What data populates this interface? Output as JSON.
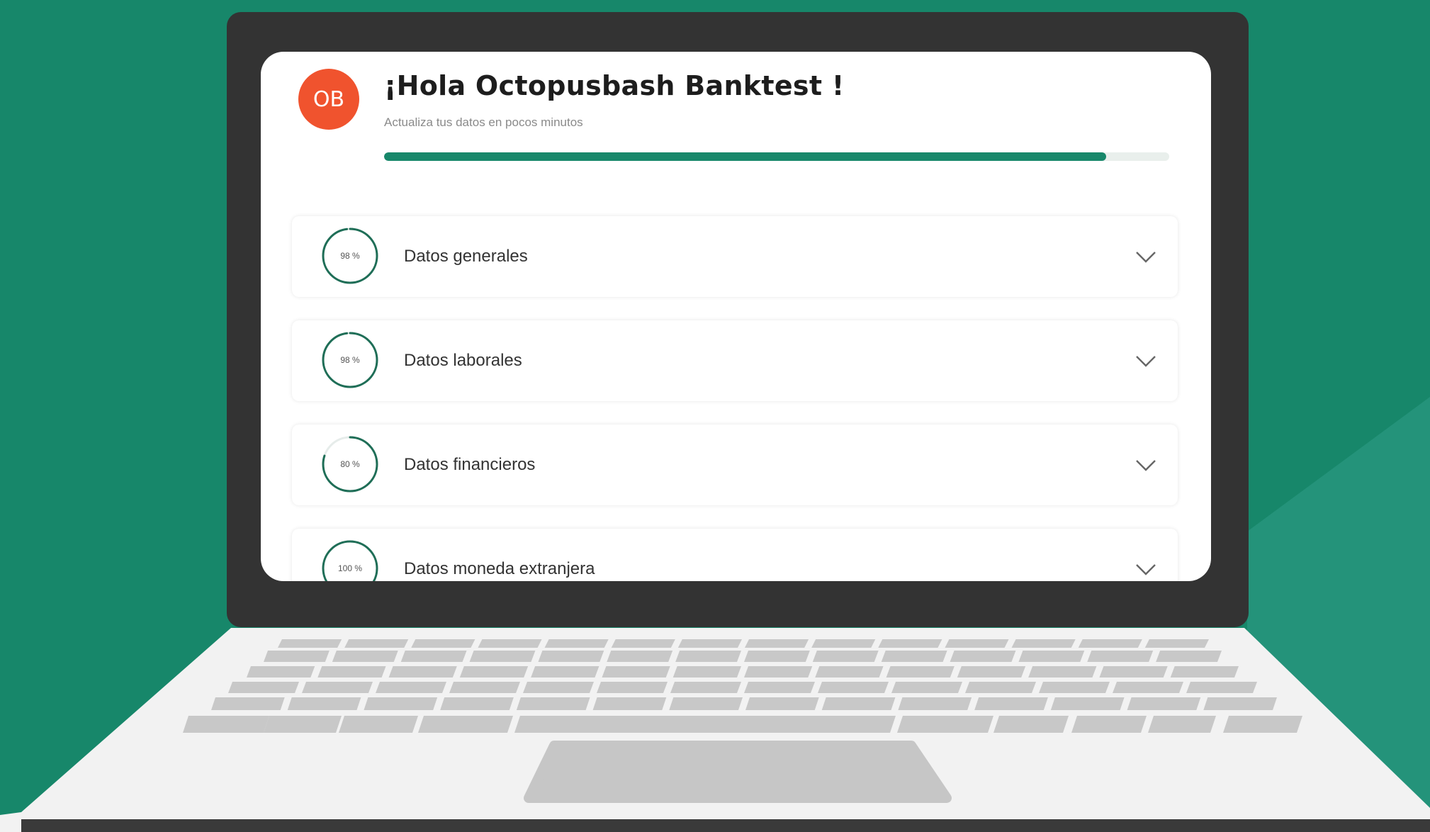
{
  "colors": {
    "background": "#17876a",
    "accent": "#17876a",
    "avatar": "#f0532e",
    "lid": "#333333",
    "laptop_base": "#f2f2f2",
    "keys": "#c8c8c8"
  },
  "header": {
    "avatar_initials": "OB",
    "greeting": "¡Hola Octopusbash Banktest !",
    "subtitle": "Actualiza tus datos en pocos minutos",
    "progress": 0.92
  },
  "sections": [
    {
      "label": "Datos generales",
      "percent_label": "98 %",
      "progress": 0.98,
      "icon": "chevron-down-icon"
    },
    {
      "label": "Datos laborales",
      "percent_label": "98 %",
      "progress": 0.98,
      "icon": "chevron-down-icon"
    },
    {
      "label": "Datos financieros",
      "percent_label": "80 %",
      "progress": 0.8,
      "icon": "chevron-down-icon"
    },
    {
      "label": "Datos moneda extranjera",
      "percent_label": "100 %",
      "progress": 1.0,
      "icon": "chevron-down-icon"
    }
  ]
}
